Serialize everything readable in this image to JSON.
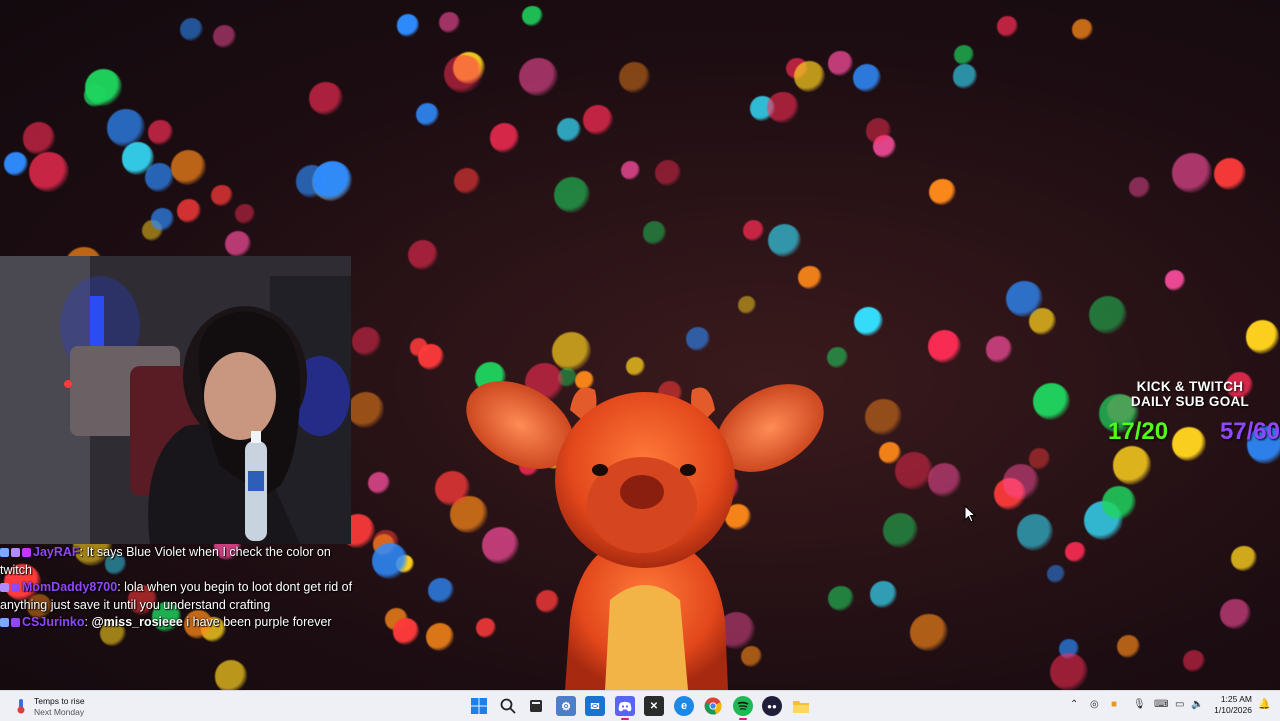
{
  "subgoal": {
    "title_line1": "KICK & TWITCH",
    "title_line2": "DAILY SUB GOAL",
    "kick_count": "17/20",
    "twitch_count": "57/60",
    "kick_color": "#53fc18",
    "twitch_color": "#9146ff"
  },
  "chat": {
    "messages": [
      {
        "username": "JayRAF",
        "user_color": "#9146ff",
        "text": ": It says Blue Violet when I check the color on twitch"
      },
      {
        "username": "MomDaddy8700",
        "user_color": "#9146ff",
        "text": ": lola when you begin to loot dont get rid of anything just save it until you understand crafting"
      },
      {
        "username": "CSJurinko",
        "user_color": "#9146ff",
        "mention": "@miss_rosieee",
        "text": " i have been purple forever"
      }
    ]
  },
  "taskbar": {
    "weather_line1": "Temps to rise",
    "weather_line2": "Next Monday",
    "clock_time": "1:25 AM",
    "clock_date": "1/10/2026",
    "apps": [
      "start-icon",
      "search-icon",
      "terminal-icon",
      "settings-icon",
      "outlook-icon",
      "discord-icon",
      "excel-icon",
      "edge-icon",
      "chrome-icon",
      "spotify-icon",
      "app-icon",
      "file-explorer-icon"
    ]
  }
}
